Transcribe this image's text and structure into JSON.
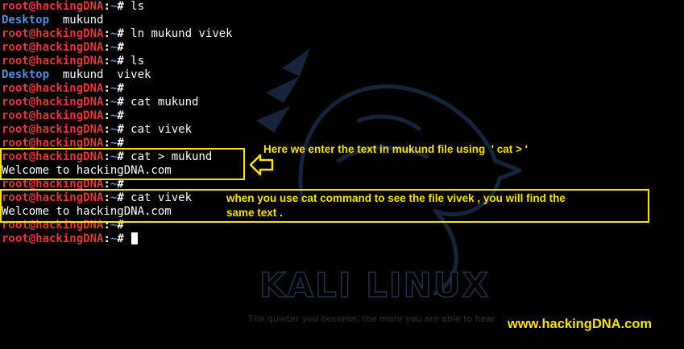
{
  "terminal": {
    "prompt": {
      "user_host": "root@hackingDNA",
      "separator": ":",
      "path": "~",
      "symbol": "# "
    },
    "lines": [
      {
        "command": "ls"
      },
      {
        "output_dir": "Desktop",
        "output_rest": "  mukund"
      },
      {
        "command": "ln mukund vivek"
      },
      {
        "command": ""
      },
      {
        "command": "ls"
      },
      {
        "output_dir": "Desktop",
        "output_rest": "  mukund  vivek"
      },
      {
        "command": ""
      },
      {
        "command": "cat mukund"
      },
      {
        "command": ""
      },
      {
        "command": "cat vivek"
      },
      {
        "command": ""
      },
      {
        "command": "cat > mukund"
      },
      {
        "output": "Welcome to hackingDNA.com"
      },
      {
        "command": ""
      },
      {
        "command": "cat vivek"
      },
      {
        "output": "Welcome to hackingDNA.com"
      },
      {
        "command": ""
      },
      {
        "command": ""
      }
    ]
  },
  "annotations": {
    "cat_write_note": "Here we enter the text in mukund file using  ' cat > '",
    "cat_read_note_line1": "when you use cat command to see the file vivek , you will find the",
    "cat_read_note_line2": "same text ."
  },
  "wallpaper": {
    "title": "KALI LINUX",
    "tagline": "The quieter you become, the more you are able to hear"
  },
  "watermark": "www.hackingDNA.com",
  "colors": {
    "background": "#000000",
    "prompt_user": "#e3393c",
    "prompt_path": "#5c8dd6",
    "annotation": "#f6e317"
  }
}
